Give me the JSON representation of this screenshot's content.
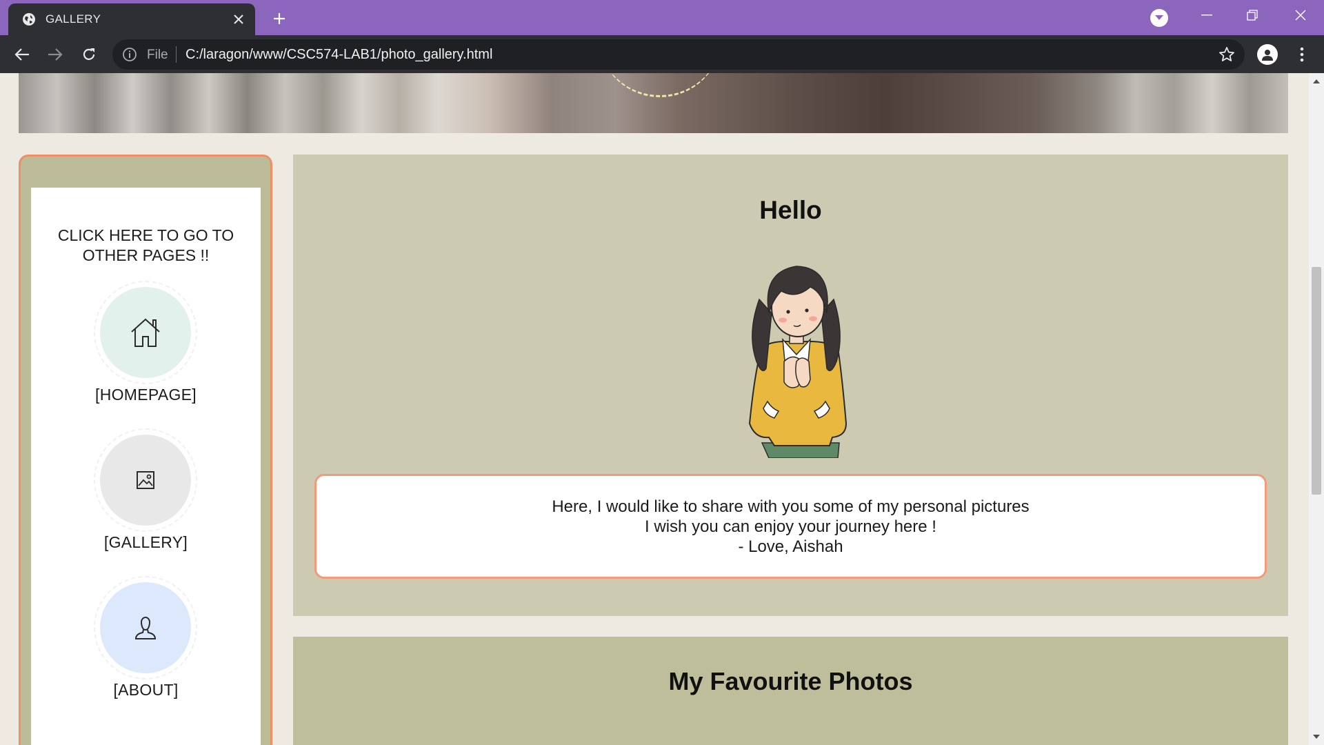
{
  "browser": {
    "tab_title": "GALLERY",
    "omnibox_scheme_label": "File",
    "url": "C:/laragon/www/CSC574-LAB1/photo_gallery.html",
    "accent_color": "#8b66bc"
  },
  "sidebar": {
    "heading": "CLICK HERE TO GO TO OTHER PAGES !!",
    "items": [
      {
        "label": "[HOMEPAGE]",
        "icon": "home-icon",
        "circle_color": "#e3f1ec"
      },
      {
        "label": "[GALLERY]",
        "icon": "image-icon",
        "circle_color": "#e8e8e8"
      },
      {
        "label": "[ABOUT]",
        "icon": "user-icon",
        "circle_color": "#dce9fd"
      }
    ]
  },
  "hello": {
    "title": "Hello",
    "message_lines": [
      "Here, I would like to share with you some of my personal pictures",
      "I wish you can enjoy your journey here !",
      "- Love, Aishah"
    ]
  },
  "favourites": {
    "title": "My Favourite Photos"
  },
  "colors": {
    "sidebar_border": "#ef8f67",
    "panel_bg": "#cccbb1",
    "panel_fav_bg": "#bfbe9b",
    "page_bg": "#eceae1"
  }
}
